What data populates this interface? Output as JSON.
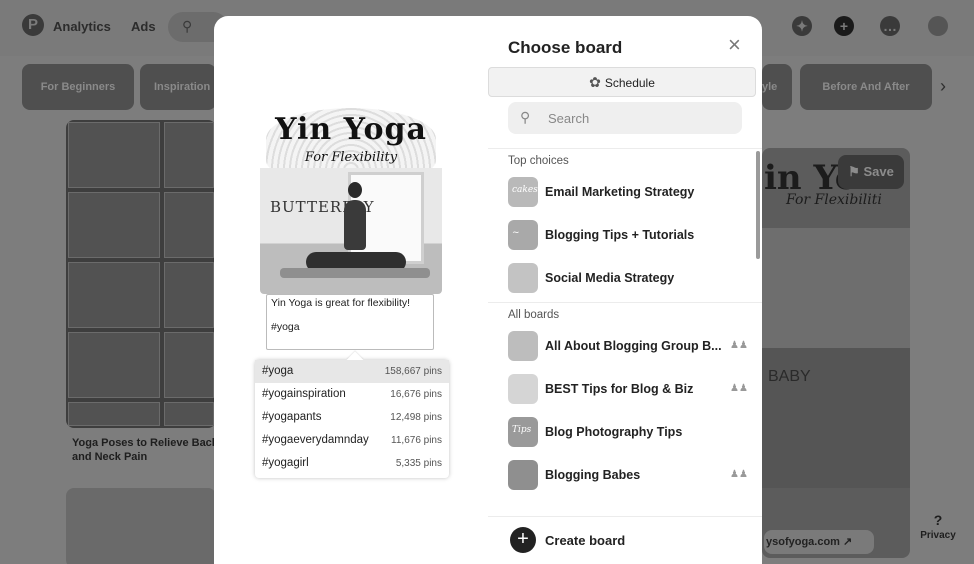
{
  "header": {
    "nav": [
      "Analytics",
      "Ads"
    ],
    "logo": "P"
  },
  "chips": [
    "For Beginners",
    "Inspiration",
    "yle",
    "Before And After"
  ],
  "background": {
    "pin_title": "Yoga Poses to Relieve Back and Neck Pain",
    "right_pin_save": "Save",
    "right_pin_link": "ysofyoga.com",
    "right_pin_title_partial": "in Yo",
    "right_pin_subtitle_partial": "For Flexibiliti",
    "right_pin_body_text": "BABY",
    "privacy_label": "Privacy",
    "privacy_icon": "?"
  },
  "pin": {
    "image_title": "Yin Yoga",
    "image_subtitle": "For Flexibility",
    "image_pose": "BUTTERFLY",
    "description_line1": "Yin Yoga is great for flexibility!",
    "description_line2": "#yoga"
  },
  "hashtags": [
    {
      "tag": "#yoga",
      "count": "158,667 pins",
      "active": true
    },
    {
      "tag": "#yogainspiration",
      "count": "16,676 pins"
    },
    {
      "tag": "#yogapants",
      "count": "12,498 pins"
    },
    {
      "tag": "#yogaeverydamnday",
      "count": "11,676 pins"
    },
    {
      "tag": "#yogagirl",
      "count": "5,335 pins"
    }
  ],
  "chooser": {
    "title": "Choose board",
    "close_icon": "×",
    "schedule_label": "Schedule",
    "search_placeholder": "Search",
    "top_choices_label": "Top choices",
    "all_boards_label": "All boards",
    "top_choices": [
      {
        "name": "Email Marketing Strategy",
        "thumb": "cakes",
        "color": "#b9b9b9"
      },
      {
        "name": "Blogging Tips + Tutorials",
        "thumb": "~",
        "color": "#a9a9a9"
      },
      {
        "name": "Social Media Strategy",
        "thumb": "",
        "color": "#c3c3c3"
      }
    ],
    "all_boards": [
      {
        "name": "All About Blogging Group B...",
        "thumb": "",
        "color": "#bdbdbd",
        "group": true
      },
      {
        "name": "BEST Tips for Blog & Biz",
        "thumb": "",
        "color": "#d5d5d5",
        "group": true
      },
      {
        "name": "Blog Photography Tips",
        "thumb": "Tips",
        "color": "#9a9a9a",
        "group": false
      },
      {
        "name": "Blogging Babes",
        "thumb": "",
        "color": "#8f8f8f",
        "group": true
      }
    ],
    "create_label": "Create board",
    "create_icon": "+"
  }
}
